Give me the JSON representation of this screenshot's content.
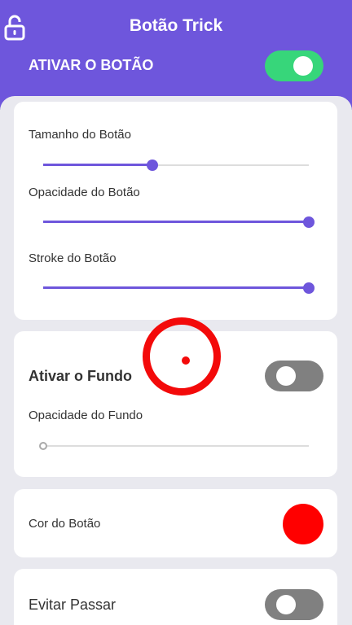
{
  "header": {
    "title": "Botão Trick",
    "activate_label": "ATIVAR O BOTÃO",
    "activate_on": true,
    "lock_icon": "unlock-icon"
  },
  "button_settings": {
    "size_label": "Tamanho do Botão",
    "size_value": 0.41,
    "opacity_label": "Opacidade do Botão",
    "opacity_value": 1.0,
    "stroke_label": "Stroke do Botão",
    "stroke_value": 1.0
  },
  "background_settings": {
    "activate_label": "Ativar o Fundo",
    "activate_on": false,
    "opacity_label": "Opacidade do Fundo",
    "opacity_value": 0.0
  },
  "color_settings": {
    "label": "Cor do Botão",
    "color": "#ff0000"
  },
  "avoid_settings": {
    "label": "Evitar Passar",
    "on": false
  },
  "colors": {
    "accent": "#6e56dc",
    "toggle_on": "#37d67a",
    "toggle_off": "#808080",
    "floating_button": "#f30a0a"
  }
}
